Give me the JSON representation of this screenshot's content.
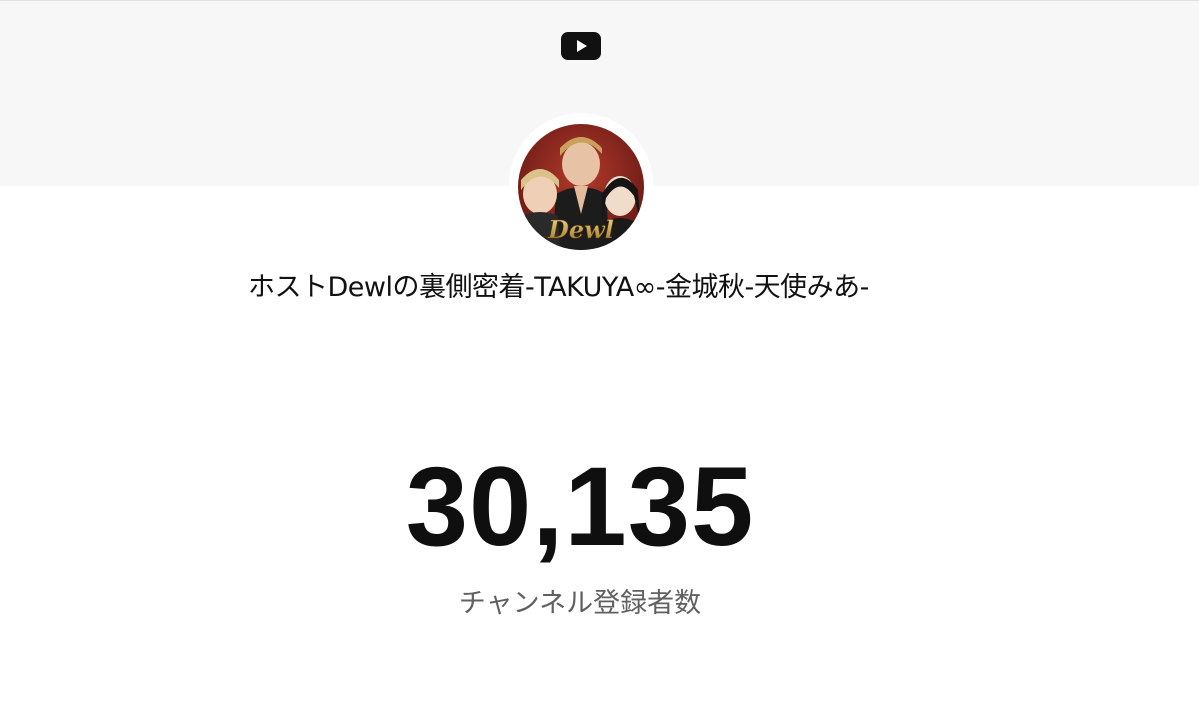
{
  "header": {
    "logo_icon": "youtube-play-icon",
    "brand_red": "#000000"
  },
  "channel": {
    "avatar_logo_text": "Dewl",
    "name": "ホストDewlの裏側密着-TAKUYA∞-金城秋-天使みあ-"
  },
  "stats": {
    "subscriber_count": "30,135",
    "subscriber_label": "チャンネル登録者数"
  },
  "colors": {
    "banner_bg": "#f7f7f7",
    "count_text": "#0f0f0f",
    "label_text": "#606060"
  }
}
